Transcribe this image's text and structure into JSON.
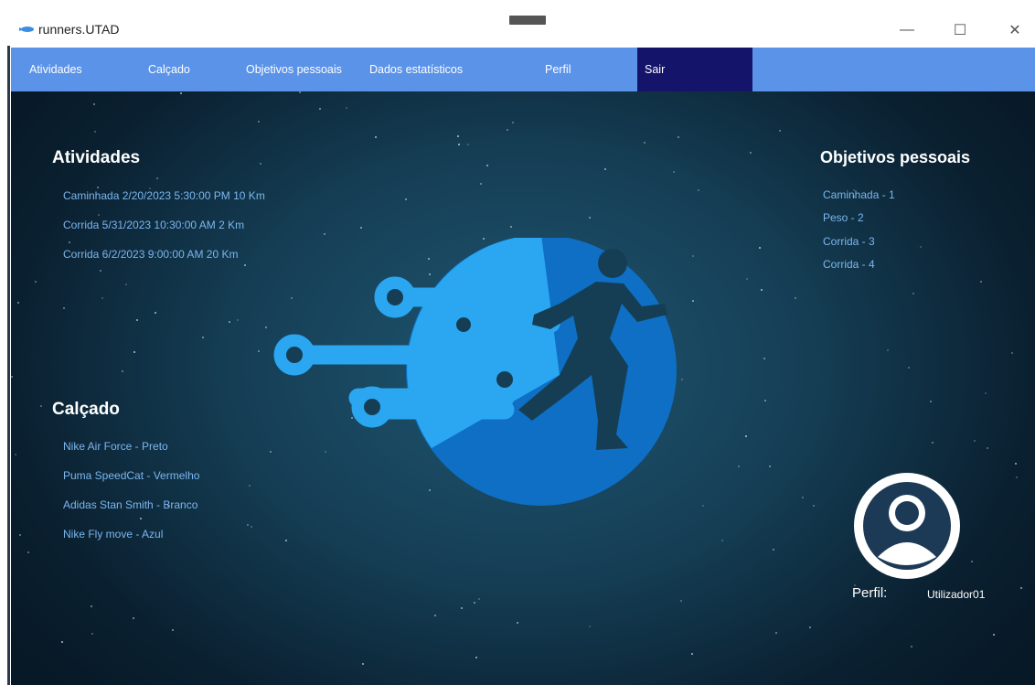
{
  "window": {
    "title": "runners.UTAD",
    "minimize_glyph": "—",
    "maximize_glyph": "☐",
    "close_glyph": "✕"
  },
  "nav": {
    "items": [
      {
        "label": "Atividades"
      },
      {
        "label": "Calçado"
      },
      {
        "label": "Objetivos pessoais"
      },
      {
        "label": "Dados estatísticos"
      },
      {
        "label": "Perfil"
      },
      {
        "label": "Sair"
      }
    ],
    "active_index": 5
  },
  "atividades": {
    "title": "Atividades",
    "items": [
      {
        "text": "Caminhada   2/20/2023 5:30:00 PM   10 Km"
      },
      {
        "text": "Corrida   5/31/2023 10:30:00 AM   2 Km"
      },
      {
        "text": "Corrida   6/2/2023 9:00:00 AM   20 Km"
      }
    ]
  },
  "calcado": {
    "title": "Calçado",
    "items": [
      {
        "text": "Nike  Air Force - Preto"
      },
      {
        "text": "Puma  SpeedCat - Vermelho"
      },
      {
        "text": "Adidas  Stan Smith - Branco"
      },
      {
        "text": "Nike  Fly move - Azul"
      }
    ]
  },
  "objetivos": {
    "title": "Objetivos pessoais",
    "items": [
      {
        "text": "Caminhada - 1"
      },
      {
        "text": "Peso - 2"
      },
      {
        "text": "Corrida - 3"
      },
      {
        "text": "Corrida - 4"
      }
    ]
  },
  "perfil": {
    "label": "Perfil:",
    "username": "Utilizador01",
    "icon": "user-avatar-icon"
  },
  "colors": {
    "nav_bg": "#5b93e8",
    "nav_active": "#14146a",
    "link_text": "#7bb6ee",
    "logo_light": "#2aa7f0",
    "logo_dark": "#0e6fc4"
  }
}
